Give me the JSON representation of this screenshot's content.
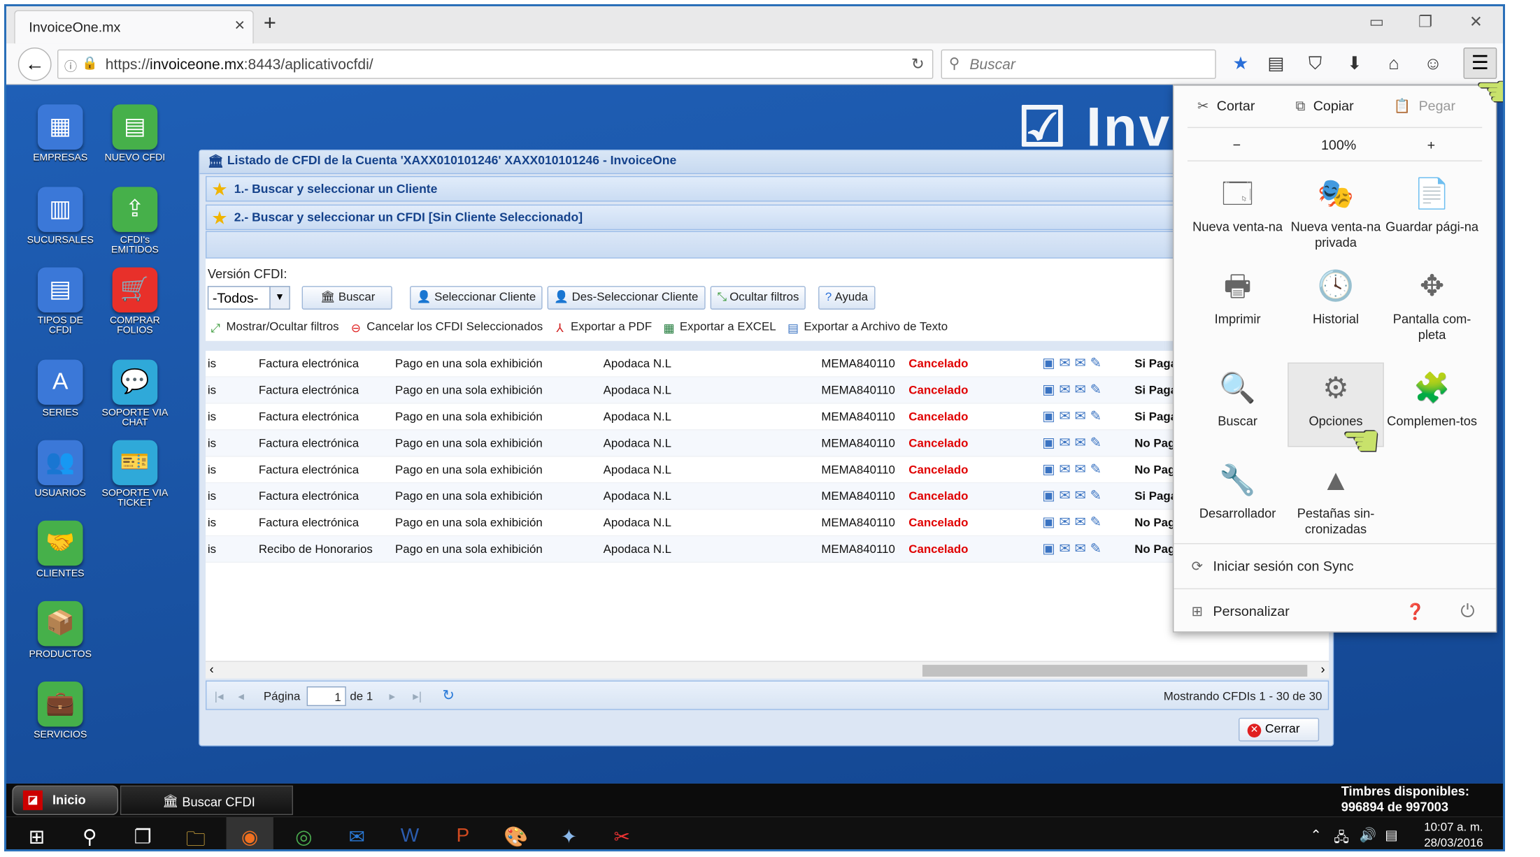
{
  "browser": {
    "tab_title": "InvoiceOne.mx",
    "url_prefix": "https://",
    "url_domain": "invoiceone.mx",
    "url_rest": ":8443/aplicativocfdi/",
    "search_placeholder": "Buscar"
  },
  "desktop": {
    "logo_text": "Invo",
    "icons": [
      {
        "label": "EMPRESAS",
        "color": "#3b78d8",
        "glyph": "▦"
      },
      {
        "label": "NUEVO CFDI",
        "color": "#46b04a",
        "glyph": "▤"
      },
      {
        "label": "SUCURSALES",
        "color": "#3b78d8",
        "glyph": "▥"
      },
      {
        "label": "CFDI's EMITIDOS",
        "color": "#46b04a",
        "glyph": "⇪"
      },
      {
        "label": "TIPOS DE CFDI",
        "color": "#3b78d8",
        "glyph": "▤"
      },
      {
        "label": "COMPRAR FOLIOS",
        "color": "#e8302a",
        "glyph": "🛒"
      },
      {
        "label": "SERIES",
        "color": "#3b78d8",
        "glyph": "A"
      },
      {
        "label": "SOPORTE VIA CHAT",
        "color": "#2fa9d9",
        "glyph": "💬"
      },
      {
        "label": "USUARIOS",
        "color": "#3b78d8",
        "glyph": "👥"
      },
      {
        "label": "SOPORTE VIA TICKET",
        "color": "#2fa9d9",
        "glyph": "🎫"
      },
      {
        "label": "CLIENTES",
        "color": "#46b04a",
        "glyph": "🤝"
      },
      {
        "label": "PRODUCTOS",
        "color": "#46b04a",
        "glyph": "📦"
      },
      {
        "label": "SERVICIOS",
        "color": "#46b04a",
        "glyph": "💼"
      }
    ]
  },
  "window": {
    "title": "Listado de CFDI de la Cuenta 'XAXX010101246' XAXX010101246 - InvoiceOne",
    "section1": "1.- Buscar y seleccionar un Cliente",
    "section2": "2.- Buscar y seleccionar un CFDI [Sin Cliente Seleccionado]",
    "version_label": "Versión CFDI:",
    "version_value": "-Todos-",
    "buttons": {
      "buscar": "Buscar",
      "seleccionar": "Seleccionar Cliente",
      "deseleccionar": "Des-Seleccionar Cliente",
      "ocultar": "Ocultar filtros",
      "ayuda": "Ayuda"
    },
    "toolbar": {
      "mostrar": "Mostrar/Ocultar filtros",
      "cancelar": "Cancelar los CFDI Seleccionados",
      "pdf": "Exportar a PDF",
      "excel": "Exportar a EXCEL",
      "texto": "Exportar a Archivo de Texto"
    },
    "rows": [
      {
        "c0": "is",
        "tipo": "Factura electrónica",
        "pago": "Pago en una sola exhibición",
        "lugar": "Apodaca N.L",
        "rfc": "MEMA840110",
        "estado": "Cancelado",
        "pagado": "Si Paga"
      },
      {
        "c0": "is",
        "tipo": "Factura electrónica",
        "pago": "Pago en una sola exhibición",
        "lugar": "Apodaca N.L",
        "rfc": "MEMA840110",
        "estado": "Cancelado",
        "pagado": "Si Paga"
      },
      {
        "c0": "is",
        "tipo": "Factura electrónica",
        "pago": "Pago en una sola exhibición",
        "lugar": "Apodaca N.L",
        "rfc": "MEMA840110",
        "estado": "Cancelado",
        "pagado": "Si Paga"
      },
      {
        "c0": "is",
        "tipo": "Factura electrónica",
        "pago": "Pago en una sola exhibición",
        "lugar": "Apodaca N.L",
        "rfc": "MEMA840110",
        "estado": "Cancelado",
        "pagado": "No Paga"
      },
      {
        "c0": "is",
        "tipo": "Factura electrónica",
        "pago": "Pago en una sola exhibición",
        "lugar": "Apodaca N.L",
        "rfc": "MEMA840110",
        "estado": "Cancelado",
        "pagado": "No Paga"
      },
      {
        "c0": "is",
        "tipo": "Factura electrónica",
        "pago": "Pago en una sola exhibición",
        "lugar": "Apodaca N.L",
        "rfc": "MEMA840110",
        "estado": "Cancelado",
        "pagado": "Si Paga"
      },
      {
        "c0": "is",
        "tipo": "Factura electrónica",
        "pago": "Pago en una sola exhibición",
        "lugar": "Apodaca N.L",
        "rfc": "MEMA840110",
        "estado": "Cancelado",
        "pagado": "No Paga"
      },
      {
        "c0": "is",
        "tipo": "Recibo de Honorarios",
        "pago": "Pago en una sola exhibición",
        "lugar": "Apodaca N.L",
        "rfc": "MEMA840110",
        "estado": "Cancelado",
        "pagado": "No Paga"
      }
    ],
    "pager": {
      "pagina_label": "Página",
      "page": "1",
      "de": "de 1",
      "showing": "Mostrando CFDIs 1 - 30 de 30"
    },
    "close_label": "Cerrar"
  },
  "menu": {
    "cortar": "Cortar",
    "copiar": "Copiar",
    "pegar": "Pegar",
    "zoom_minus": "−",
    "zoom": "100%",
    "zoom_plus": "+",
    "items": [
      {
        "label": "Nueva venta-na",
        "name": "menu-new-window",
        "glyph": "🗔"
      },
      {
        "label": "Nueva venta-na privada",
        "name": "menu-private-window",
        "glyph": "🎭"
      },
      {
        "label": "Guardar pági-na",
        "name": "menu-save-page",
        "glyph": "📄"
      },
      {
        "label": "Imprimir",
        "name": "menu-print",
        "glyph": "🖶"
      },
      {
        "label": "Historial",
        "name": "menu-history",
        "glyph": "🕓"
      },
      {
        "label": "Pantalla com-pleta",
        "name": "menu-fullscreen",
        "glyph": "✥"
      },
      {
        "label": "Buscar",
        "name": "menu-find",
        "glyph": "🔍"
      },
      {
        "label": "Opciones",
        "name": "menu-options",
        "glyph": "⚙"
      },
      {
        "label": "Complemen-tos",
        "name": "menu-addons",
        "glyph": "🧩"
      },
      {
        "label": "Desarrollador",
        "name": "menu-developer",
        "glyph": "🔧"
      },
      {
        "label": "Pestañas sin-cronizadas",
        "name": "menu-synced-tabs",
        "glyph": "▲"
      }
    ],
    "sync": "Iniciar sesión con Sync",
    "personalizar": "Personalizar"
  },
  "appbar": {
    "inicio": "Inicio",
    "task": "Buscar CFDI",
    "timbres_label": "Timbres disponibles:",
    "timbres_value": "996894 de 997003"
  },
  "taskbar": {
    "time": "10:07 a. m.",
    "date": "28/03/2016"
  }
}
